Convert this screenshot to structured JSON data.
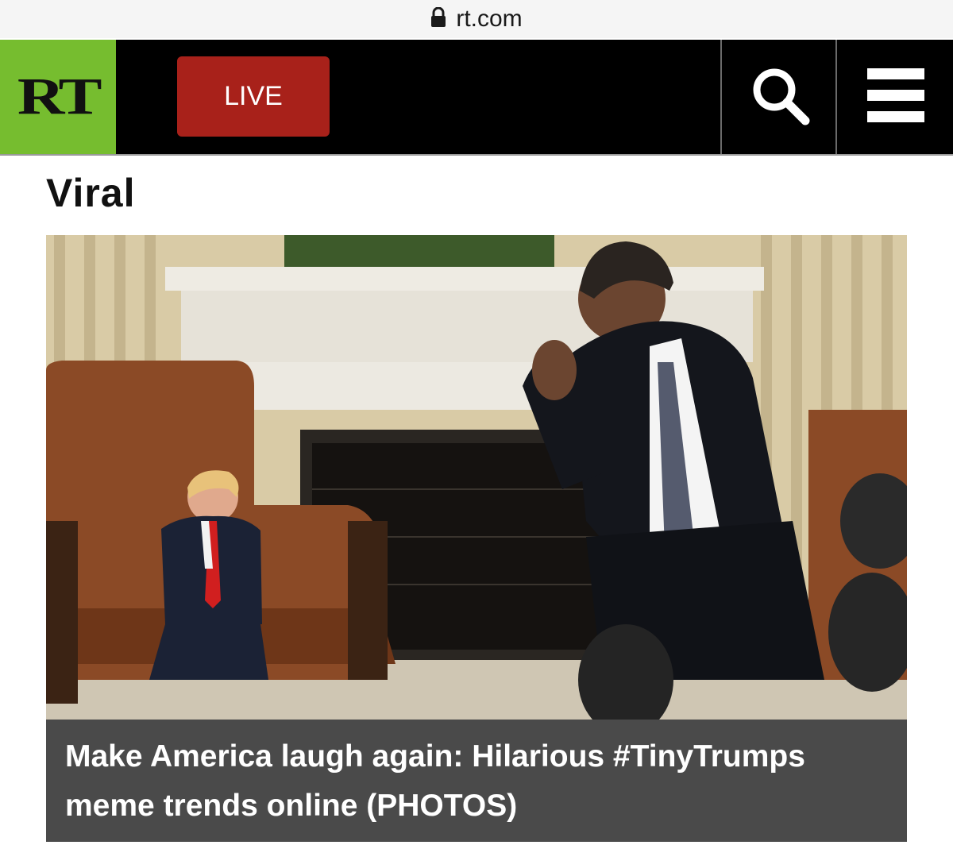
{
  "browser": {
    "url": "rt.com",
    "lock_icon": "lock-icon"
  },
  "header": {
    "logo_text": "RT",
    "live_label": "LIVE",
    "search_icon": "search-icon",
    "menu_icon": "hamburger-menu-icon",
    "colors": {
      "logo_bg": "#76bd2f",
      "live_bg": "#a8211a",
      "bar_bg": "#000000"
    }
  },
  "section": {
    "title": "Viral"
  },
  "article": {
    "headline": "Make America laugh again: Hilarious #TinyTrumps meme trends online (PHOTOS)",
    "caption_bg": "#4a4a4a"
  }
}
